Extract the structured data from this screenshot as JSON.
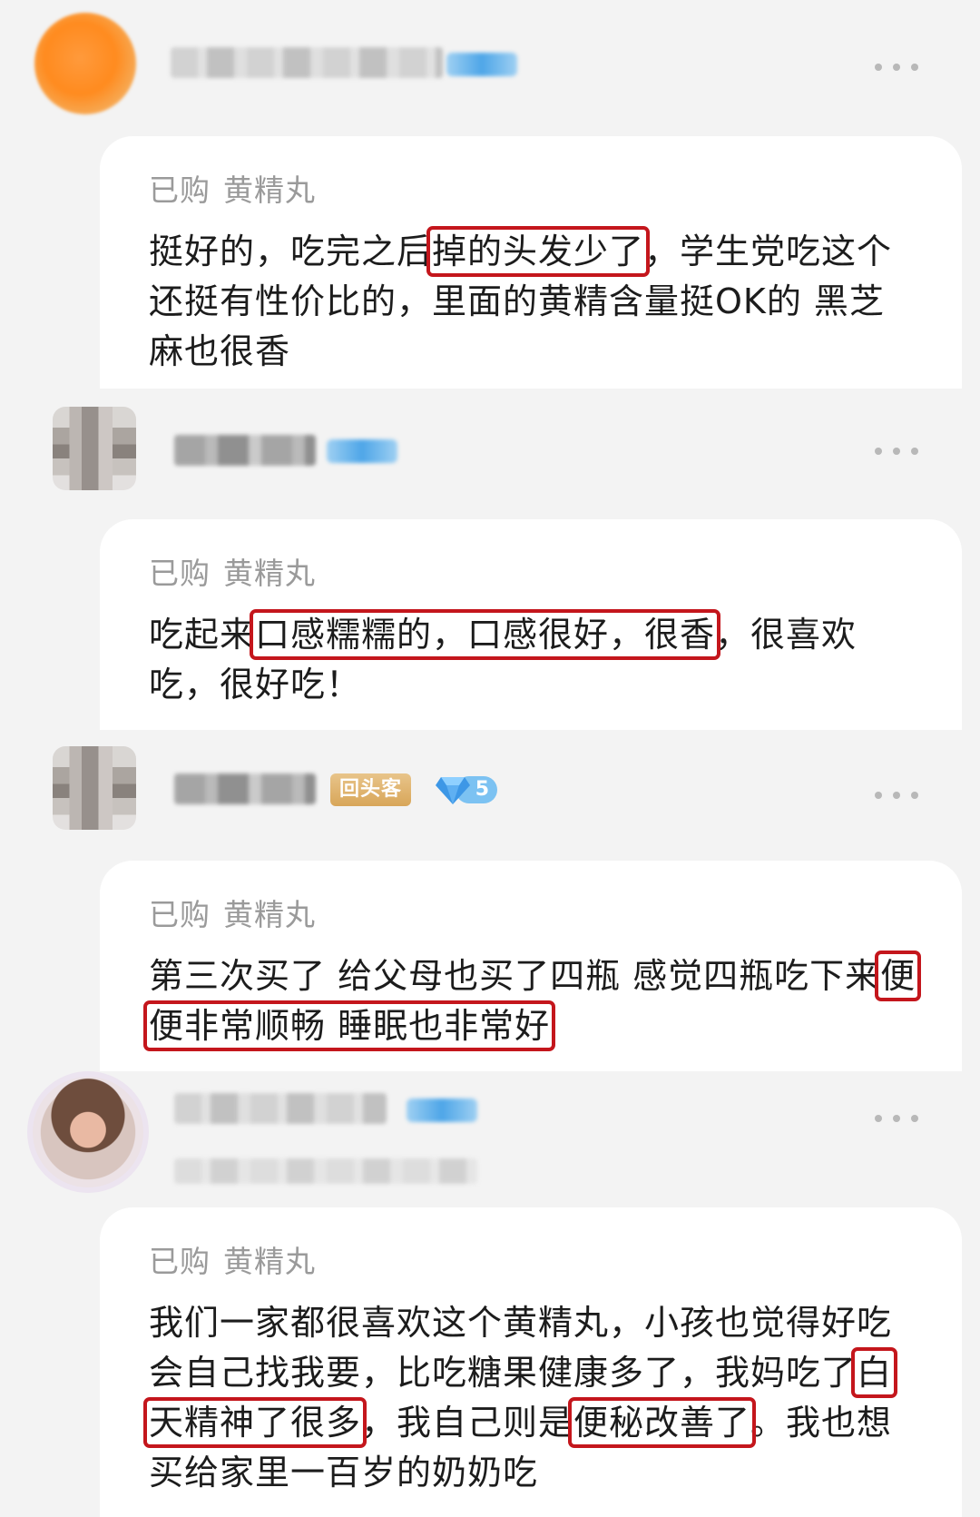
{
  "reviews": [
    {
      "purchase_label": "已购",
      "product": "黄精丸",
      "text": [
        {
          "t": "挺好的，吃完之后"
        },
        {
          "t": "掉的头发少了",
          "hl": true
        },
        {
          "t": "，学生党吃这个还挺有性价比的，里面的黄精含量挺OK的 黑芝麻也很香"
        }
      ]
    },
    {
      "purchase_label": "已购",
      "product": "黄精丸",
      "text": [
        {
          "t": "吃起来"
        },
        {
          "t": "口感糯糯的，口感很好，很香",
          "hl": true
        },
        {
          "t": "，很喜欢吃，很好吃！"
        }
      ]
    },
    {
      "badge_returning": "回头客",
      "diamond_level": "5",
      "purchase_label": "已购",
      "product": "黄精丸",
      "text": [
        {
          "t": "第三次买了 给父母也买了四瓶 感觉四瓶吃下来"
        },
        {
          "t": "便便非常顺畅 睡眠也非常好",
          "hl": true
        }
      ]
    },
    {
      "purchase_label": "已购",
      "product": "黄精丸",
      "text": [
        {
          "t": "我们一家都很喜欢这个黄精丸，小孩也觉得好吃会自己找我要，比吃糖果健康多了，我妈吃了"
        },
        {
          "t": "白天精神了很多",
          "hl": true
        },
        {
          "t": "，我自己则是"
        },
        {
          "t": "便秘改善了",
          "hl": true
        },
        {
          "t": "。我也想买给家里一百岁的奶奶吃"
        }
      ]
    }
  ],
  "colors": {
    "background": "#f3f3f3",
    "card": "#ffffff",
    "highlight_box": "#c4161c",
    "muted_text": "#9a9a9a",
    "badge_gold": "#d8a659",
    "badge_blue": "#7cc2f2"
  },
  "icons": [
    "more-options-icon",
    "diamond-icon"
  ]
}
